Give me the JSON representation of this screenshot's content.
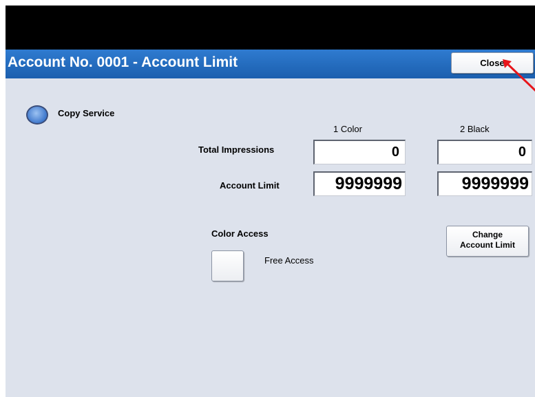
{
  "window": {
    "title": "Account No. 0001 - Account Limit",
    "close_label": "Close"
  },
  "service": {
    "label": "Copy Service"
  },
  "columns": {
    "color": "1 Color",
    "black": "2 Black"
  },
  "rows": {
    "total_impressions": {
      "label": "Total Impressions",
      "color": "0",
      "black": "0"
    },
    "account_limit": {
      "label": "Account Limit",
      "color": "9999999",
      "black": "9999999"
    }
  },
  "change_limit": {
    "line1": "Change",
    "line2": "Account Limit"
  },
  "color_access": {
    "heading": "Color Access",
    "option_label": "Free Access",
    "checked": false
  },
  "colors": {
    "title_bar": "#1f65b6",
    "background": "#dde2ec",
    "arrow": "#e8151b"
  },
  "icons": {
    "copy_service": "radio-button-icon",
    "annotation": "red-arrow-icon"
  }
}
